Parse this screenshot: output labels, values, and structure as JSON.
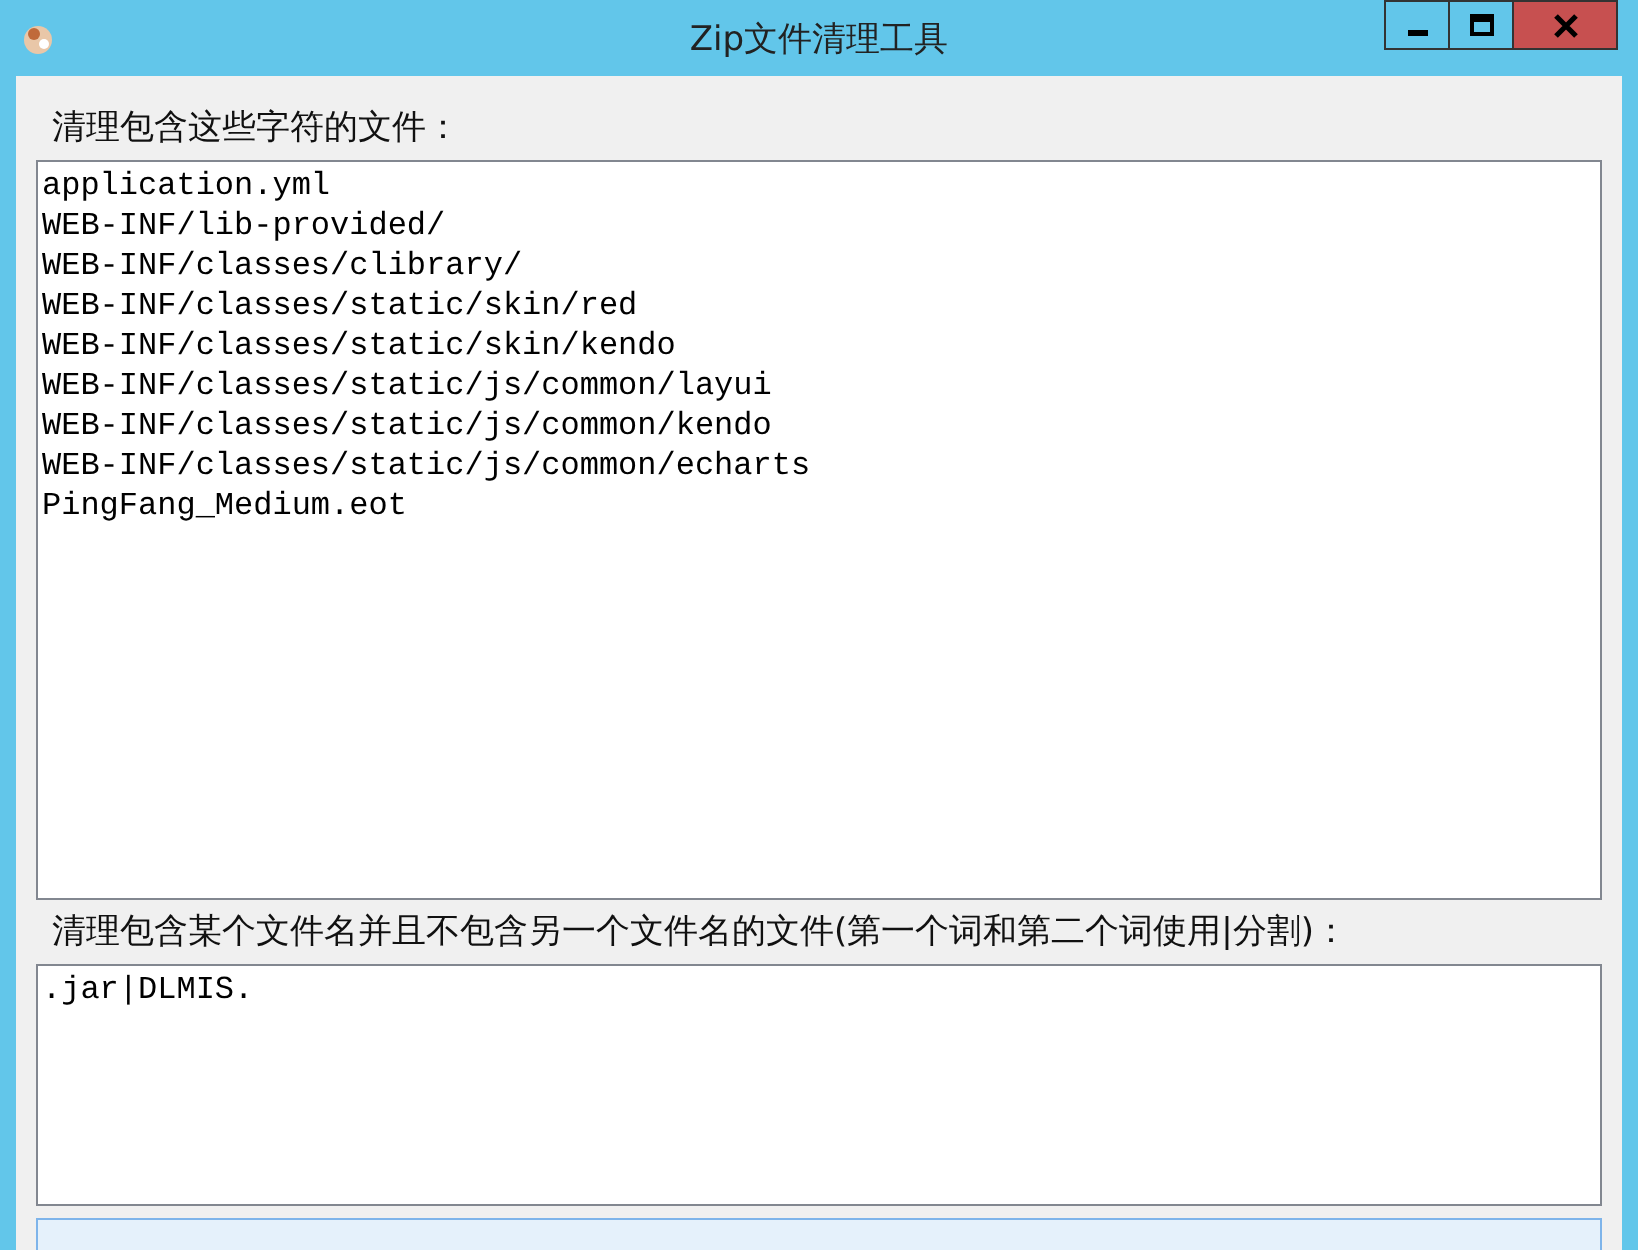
{
  "window": {
    "title": "Zip文件清理工具"
  },
  "contains_section": {
    "label": "清理包含这些字符的文件：",
    "lines": [
      "application.yml",
      "WEB-INF/lib-provided/",
      "WEB-INF/classes/clibrary/",
      "WEB-INF/classes/static/skin/red",
      "WEB-INF/classes/static/skin/kendo",
      "WEB-INF/classes/static/js/common/layui",
      "WEB-INF/classes/static/js/common/kendo",
      "WEB-INF/classes/static/js/common/echarts",
      "PingFang_Medium.eot"
    ]
  },
  "exclude_section": {
    "label": "清理包含某个文件名并且不包含另一个文件名的文件(第一个词和第二个词使用|分割)：",
    "lines": [
      ".jar|DLMIS."
    ]
  }
}
